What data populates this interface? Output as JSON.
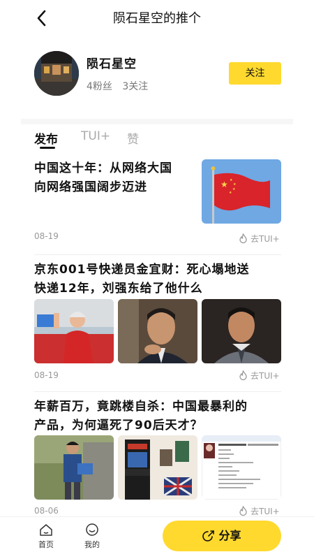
{
  "header": {
    "title": "陨石星空的推个"
  },
  "profile": {
    "name": "陨石星空",
    "followers": "4粉丝",
    "following": "3关注",
    "follow_label": "关注"
  },
  "tabs": [
    {
      "label": "发布",
      "active": true
    },
    {
      "label": "TUI+",
      "active": false
    },
    {
      "label": "赞",
      "active": false
    }
  ],
  "posts": [
    {
      "title_line1": "中国这十年：从网络大国",
      "title_line2": "向网络强国阔步迈进",
      "date": "08-19",
      "tui": "去TUI+"
    },
    {
      "title_line1": "京东001号快递员金宜财：死心塌地送",
      "title_line2": "快递12年，刘强东给了他什么",
      "date": "08-19",
      "tui": "去TUI+"
    },
    {
      "title_line1": "年薪百万，竟跳楼自杀：中国最暴利的",
      "title_line2": "产品，为何逼死了90后天才？",
      "date": "08-06",
      "tui": "去TUI+"
    }
  ],
  "bottom_nav": {
    "home": "首页",
    "mine": "我的",
    "share": "分享"
  },
  "colors": {
    "accent": "#ffd92e",
    "text": "#111111",
    "muted": "#999999"
  }
}
